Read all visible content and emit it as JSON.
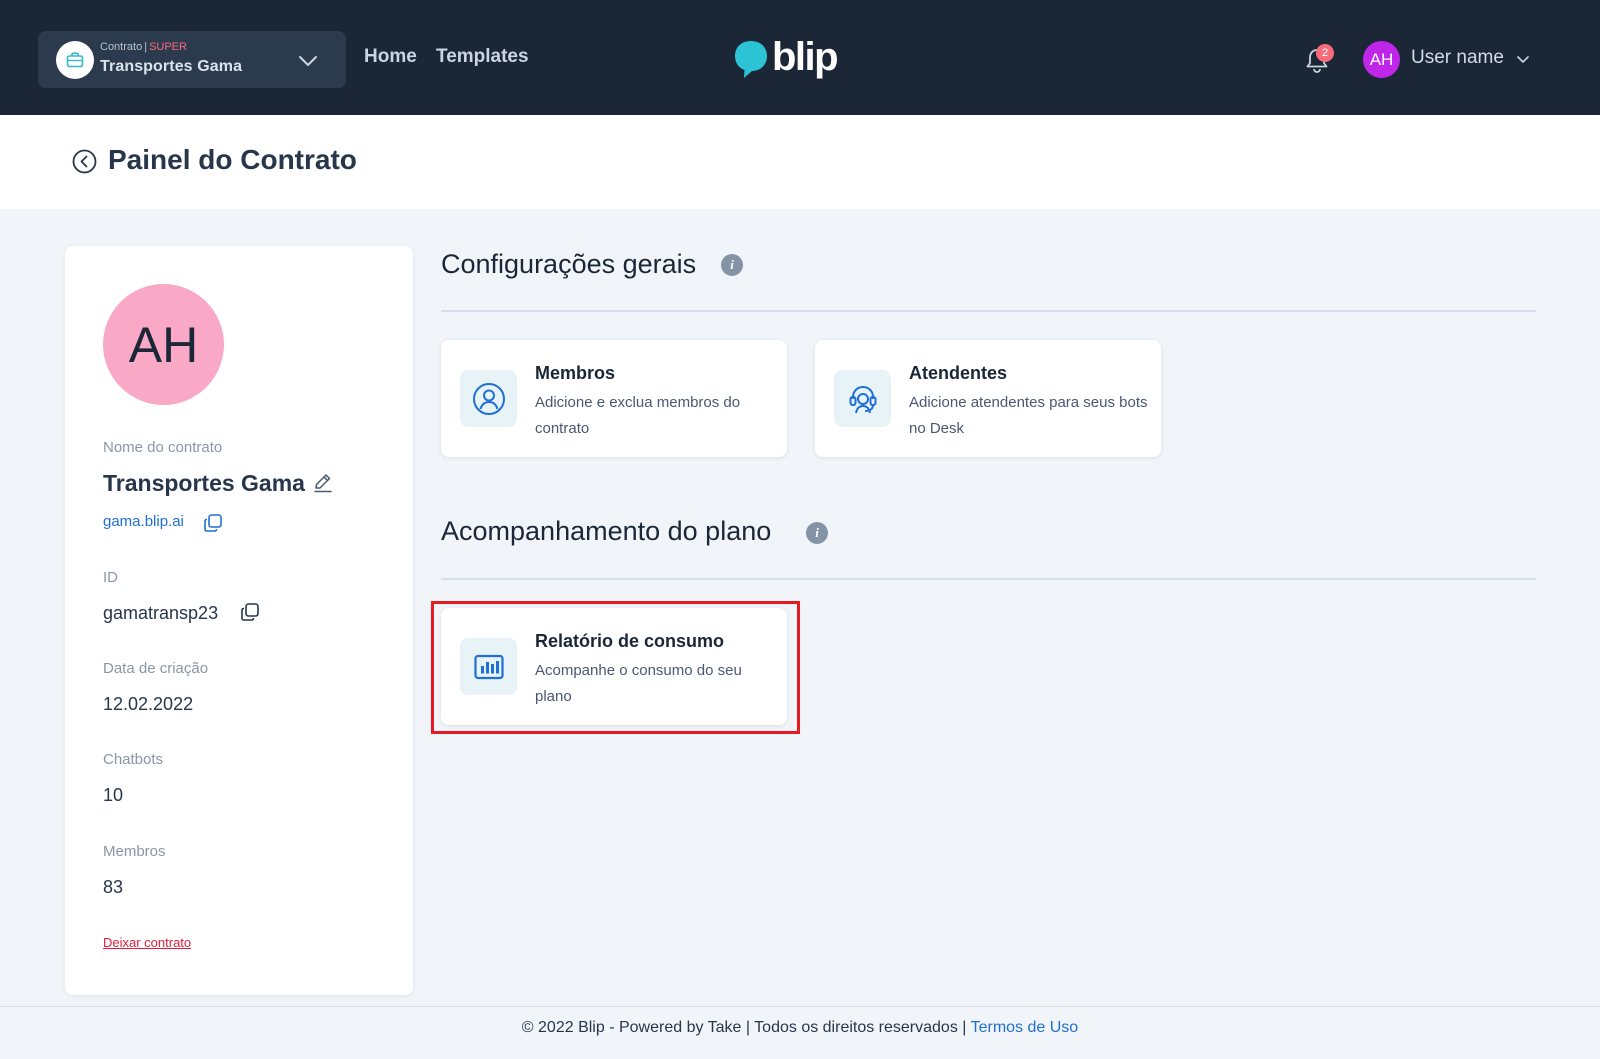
{
  "header": {
    "contract_label": "Contrato",
    "contract_separator": "|",
    "contract_tier": "SUPER",
    "contract_name": "Transportes Gama",
    "nav": {
      "home": "Home",
      "templates": "Templates"
    },
    "brand": "blip",
    "notification_count": "2",
    "user_initials": "AH",
    "user_name": "User name"
  },
  "page": {
    "title": "Painel do Contrato"
  },
  "profile": {
    "initials": "AH",
    "name_label": "Nome do contrato",
    "name": "Transportes Gama",
    "domain": "gama.blip.ai",
    "id_label": "ID",
    "id": "gamatransp23",
    "created_label": "Data de criação",
    "created": "12.02.2022",
    "chatbots_label": "Chatbots",
    "chatbots": "10",
    "members_label": "Membros",
    "members": "83",
    "leave_link": "Deixar contrato"
  },
  "sections": {
    "general": {
      "title": "Configurações gerais",
      "cards": [
        {
          "title": "Membros",
          "description": "Adicione e exclua membros do contrato",
          "icon": "user-circle-icon"
        },
        {
          "title": "Atendentes",
          "description": "Adicione atendentes para seus bots no Desk",
          "icon": "headset-icon"
        }
      ]
    },
    "plan": {
      "title": "Acompanhamento do plano",
      "cards": [
        {
          "title": "Relatório de consumo",
          "description": "Acompanhe o consumo do seu plano",
          "icon": "bar-chart-icon"
        }
      ]
    }
  },
  "footer": {
    "text": "© 2022 Blip - Powered by Take | Todos os direitos reservados | ",
    "link": "Termos de Uso"
  },
  "colors": {
    "topbar": "#1b2637",
    "accent": "#1f6fd6",
    "highlight": "#e51a22",
    "avatar_profile": "#f9a8c6",
    "avatar_user": "#c026e8"
  }
}
